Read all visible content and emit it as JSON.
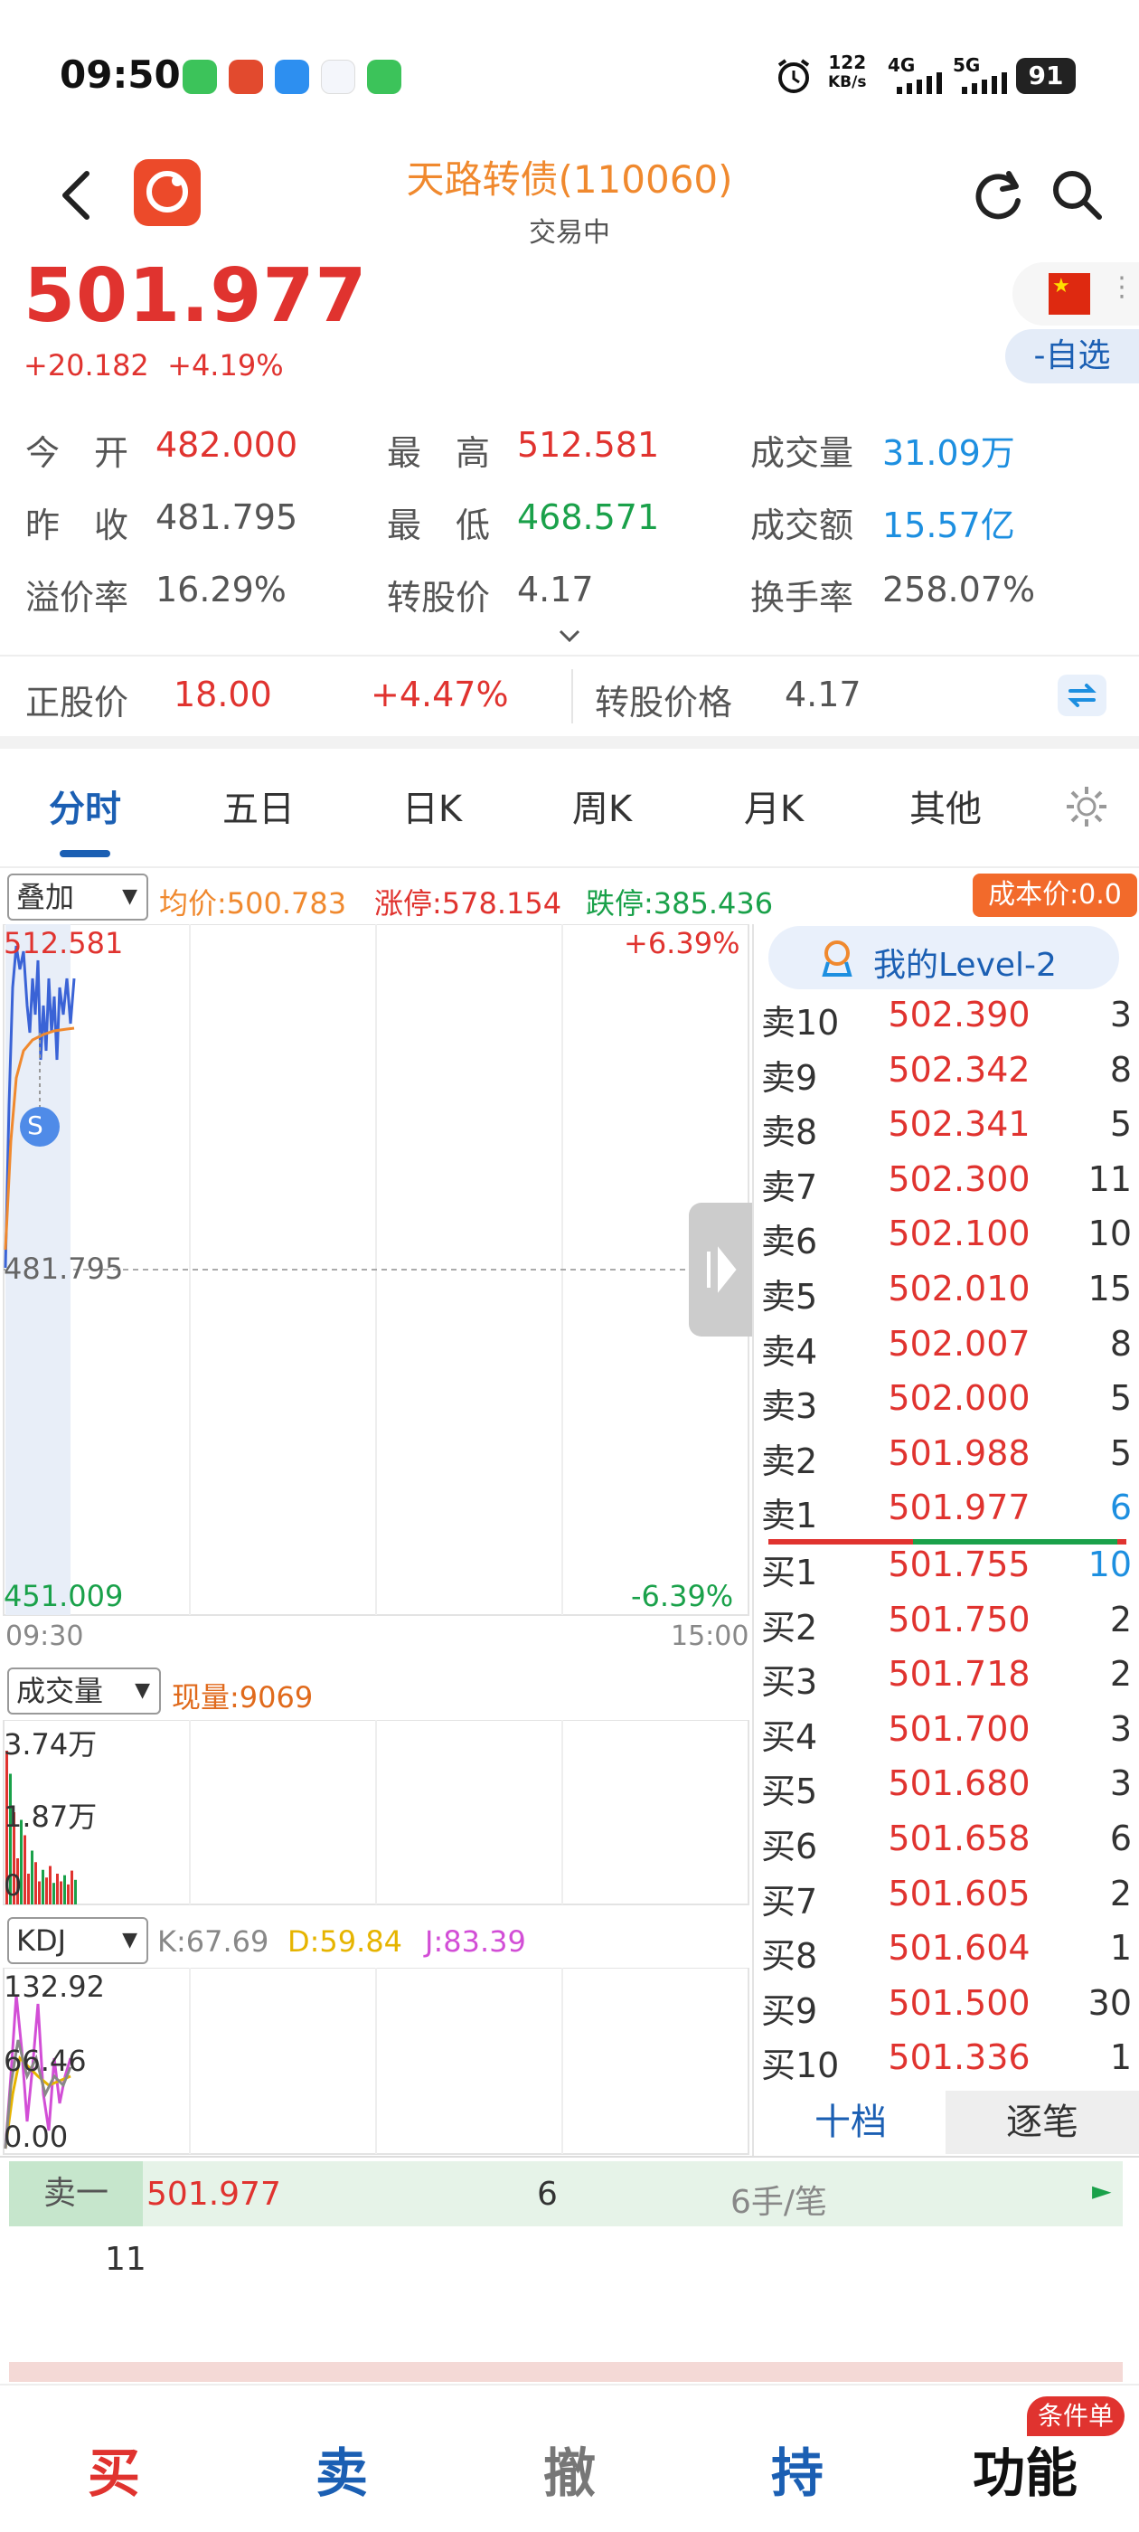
{
  "status_bar": {
    "time": "09:50",
    "speed": "122",
    "speed_unit": "KB/s",
    "net1": "4G",
    "net2": "5G",
    "battery": "91"
  },
  "header": {
    "title": "天路转债(110060)",
    "subtitle": "交易中"
  },
  "quote": {
    "price": "501.977",
    "change": "+20.182",
    "change_pct": "+4.19%",
    "watch_button": "-自选"
  },
  "stats": [
    {
      "label": "今　开",
      "value": "482.000",
      "color": "red"
    },
    {
      "label": "最　高",
      "value": "512.581",
      "color": "red"
    },
    {
      "label": "成交量",
      "value": "31.09万",
      "color": "blue"
    },
    {
      "label": "昨　收",
      "value": "481.795",
      "color": "default"
    },
    {
      "label": "最　低",
      "value": "468.571",
      "color": "green"
    },
    {
      "label": "成交额",
      "value": "15.57亿",
      "color": "blue"
    },
    {
      "label": "溢价率",
      "value": "16.29%",
      "color": "default"
    },
    {
      "label": "转股价",
      "value": "4.17",
      "color": "default"
    },
    {
      "label": "换手率",
      "value": "258.07%",
      "color": "default"
    }
  ],
  "stock_bar": {
    "label": "正股价",
    "price": "18.00",
    "pct": "+4.47%",
    "conv_label": "转股价格",
    "conv_value": "4.17"
  },
  "tabs": [
    "分时",
    "五日",
    "日K",
    "周K",
    "月K",
    "其他"
  ],
  "chart": {
    "overlay_dd": "叠加",
    "avg": "均价:500.783",
    "limit_up": "涨停:578.154",
    "limit_down": "跌停:385.436",
    "cost_badge": "成本价:0.0",
    "high": "512.581",
    "high_pct": "+6.39%",
    "mid": "481.795",
    "low": "451.009",
    "low_pct": "-6.39%",
    "t_start": "09:30",
    "t_end": "15:00",
    "marker": "S",
    "vol_dd": "成交量",
    "vol_now": "现量:9069",
    "vol_max": "3.74万",
    "vol_mid": "1.87万",
    "vol_zero": "0",
    "kdj_dd": "KDJ",
    "k": "K:67.69",
    "d": "D:59.84",
    "j": "J:83.39",
    "kdj_max": "132.92",
    "kdj_mid": "66.46",
    "kdj_min": "0.00"
  },
  "orderbook": {
    "level2": "我的Level-2",
    "asks": [
      {
        "name": "卖10",
        "price": "502.390",
        "qty": "3"
      },
      {
        "name": "卖9",
        "price": "502.342",
        "qty": "8"
      },
      {
        "name": "卖8",
        "price": "502.341",
        "qty": "5"
      },
      {
        "name": "卖7",
        "price": "502.300",
        "qty": "11"
      },
      {
        "name": "卖6",
        "price": "502.100",
        "qty": "10"
      },
      {
        "name": "卖5",
        "price": "502.010",
        "qty": "15"
      },
      {
        "name": "卖4",
        "price": "502.007",
        "qty": "8"
      },
      {
        "name": "卖3",
        "price": "502.000",
        "qty": "5"
      },
      {
        "name": "卖2",
        "price": "501.988",
        "qty": "5"
      },
      {
        "name": "卖1",
        "price": "501.977",
        "qty": "6"
      }
    ],
    "bids": [
      {
        "name": "买1",
        "price": "501.755",
        "qty": "10"
      },
      {
        "name": "买2",
        "price": "501.750",
        "qty": "2"
      },
      {
        "name": "买3",
        "price": "501.718",
        "qty": "2"
      },
      {
        "name": "买4",
        "price": "501.700",
        "qty": "3"
      },
      {
        "name": "买5",
        "price": "501.680",
        "qty": "3"
      },
      {
        "name": "买6",
        "price": "501.658",
        "qty": "6"
      },
      {
        "name": "买7",
        "price": "501.605",
        "qty": "2"
      },
      {
        "name": "买8",
        "price": "501.604",
        "qty": "1"
      },
      {
        "name": "买9",
        "price": "501.500",
        "qty": "30"
      },
      {
        "name": "买10",
        "price": "501.336",
        "qty": "1"
      }
    ],
    "tab_ten": "十档",
    "tab_tick": "逐笔"
  },
  "tape": {
    "label": "卖一",
    "price": "501.977",
    "qty": "6",
    "per": "6手/笔",
    "sub_qty": "11"
  },
  "bottom_nav": {
    "buy": "买",
    "sell": "卖",
    "cancel": "撤",
    "hold": "持",
    "func": "功能",
    "badge": "条件单"
  }
}
